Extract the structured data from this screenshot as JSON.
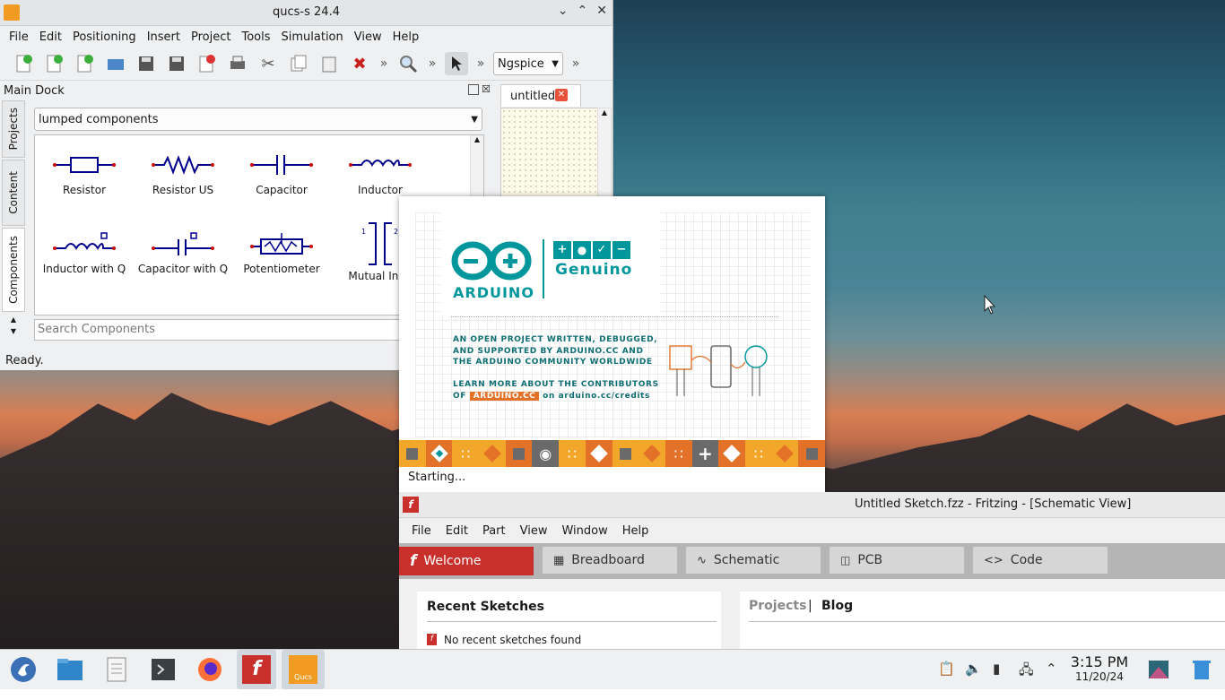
{
  "qucs": {
    "title": "qucs-s 24.4",
    "menu": [
      "File",
      "Edit",
      "Positioning",
      "Insert",
      "Project",
      "Tools",
      "Simulation",
      "View",
      "Help"
    ],
    "simulator": "Ngspice",
    "dock_title": "Main Dock",
    "side_tabs": [
      "Projects",
      "Content",
      "Components"
    ],
    "category": "lumped components",
    "components": [
      "Resistor",
      "Resistor US",
      "Capacitor",
      "Inductor",
      "Inductor with Q",
      "Capacitor with Q",
      "Potentiometer",
      "Mutual Indu"
    ],
    "search_placeholder": "Search Components",
    "status": "Ready.",
    "doc_tab": "untitled"
  },
  "splash": {
    "brand": "ARDUINO",
    "partner": "Genuino",
    "line1": "AN OPEN PROJECT WRITTEN, DEBUGGED,",
    "line2": "AND SUPPORTED BY ARDUINO.CC AND",
    "line3": "THE ARDUINO COMMUNITY WORLDWIDE",
    "line4": "LEARN MORE ABOUT THE CONTRIBUTORS",
    "line5_prefix": "OF",
    "line5_badge": "ARDUINO.CC",
    "line5_suffix": "on arduino.cc/credits",
    "status": "Starting..."
  },
  "fritzing": {
    "title": "Untitled Sketch.fzz - Fritzing - [Schematic View]",
    "menu": [
      "File",
      "Edit",
      "Part",
      "View",
      "Window",
      "Help"
    ],
    "tabs": [
      "Welcome",
      "Breadboard",
      "Schematic",
      "PCB",
      "Code"
    ],
    "recent_title": "Recent Sketches",
    "recent_empty": "No recent sketches found",
    "projects_label": "Projects",
    "separator": "|",
    "blog_label": "Blog"
  },
  "taskbar": {
    "time": "3:15 PM",
    "date": "11/20/24",
    "qucs_label": "Qucs"
  },
  "colors": {
    "arduino_teal": "#00979c",
    "arduino_orange": "#e47128",
    "fritzing_red": "#c9302c",
    "qucs_orange": "#f29b22"
  }
}
